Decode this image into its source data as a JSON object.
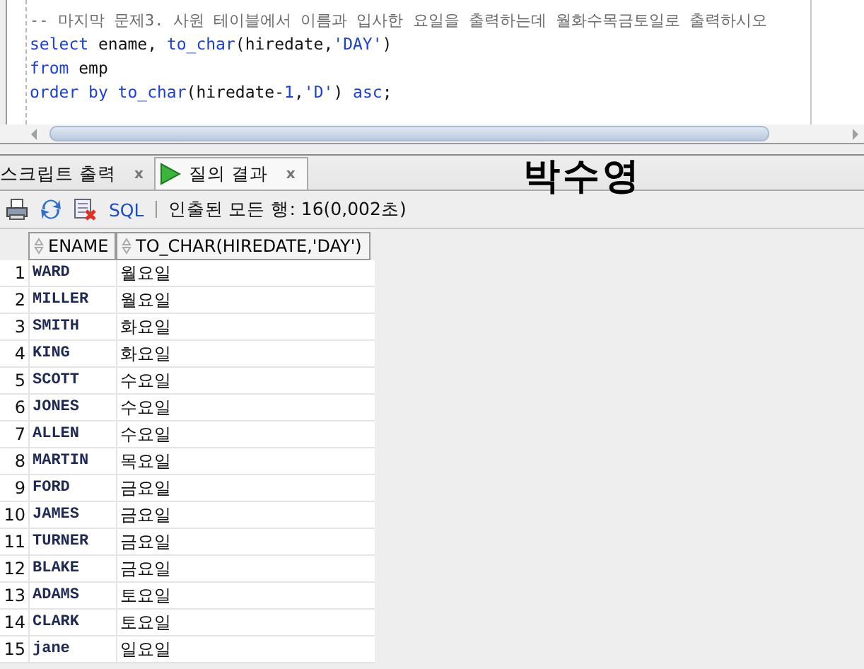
{
  "editor": {
    "lines": [
      [
        {
          "kind": "comment",
          "text": "-- 마지막 문제3. 사원 테이블에서 이름과 입사한 요일을 출력하는데 월화수목금토일로 출력하시오"
        }
      ],
      [
        {
          "kind": "keyword",
          "text": "select"
        },
        {
          "kind": "plain",
          "text": " ename, "
        },
        {
          "kind": "keyword",
          "text": "to_char"
        },
        {
          "kind": "plain",
          "text": "(hiredate,"
        },
        {
          "kind": "string",
          "text": "'DAY'"
        },
        {
          "kind": "plain",
          "text": ")"
        }
      ],
      [
        {
          "kind": "keyword",
          "text": "from"
        },
        {
          "kind": "plain",
          "text": " emp"
        }
      ],
      [
        {
          "kind": "keyword",
          "text": "order by to_char"
        },
        {
          "kind": "plain",
          "text": "(hiredate-"
        },
        {
          "kind": "string",
          "text": "1"
        },
        {
          "kind": "plain",
          "text": ","
        },
        {
          "kind": "string",
          "text": "'D'"
        },
        {
          "kind": "plain",
          "text": ") "
        },
        {
          "kind": "keyword",
          "text": "asc"
        },
        {
          "kind": "plain",
          "text": ";"
        }
      ]
    ]
  },
  "tabs": [
    {
      "label": "스크립트 출력",
      "selected": false,
      "close": "x"
    },
    {
      "label": "질의 결과",
      "selected": true,
      "close": "x"
    }
  ],
  "annotation": "박수영",
  "toolbar": {
    "sql_label": "SQL",
    "status": "인출된 모든 행: 16(0,002초)"
  },
  "table": {
    "columns": [
      "ENAME",
      "TO_CHAR(HIREDATE,'DAY')"
    ],
    "rows": [
      {
        "num": "1",
        "ename": "WARD",
        "day": "월요일"
      },
      {
        "num": "2",
        "ename": "MILLER",
        "day": "월요일"
      },
      {
        "num": "3",
        "ename": "SMITH",
        "day": "화요일"
      },
      {
        "num": "4",
        "ename": "KING",
        "day": "화요일"
      },
      {
        "num": "5",
        "ename": "SCOTT",
        "day": "수요일"
      },
      {
        "num": "6",
        "ename": "JONES",
        "day": "수요일"
      },
      {
        "num": "7",
        "ename": "ALLEN",
        "day": "수요일"
      },
      {
        "num": "8",
        "ename": "MARTIN",
        "day": "목요일"
      },
      {
        "num": "9",
        "ename": "FORD",
        "day": "금요일"
      },
      {
        "num": "10",
        "ename": "JAMES",
        "day": "금요일"
      },
      {
        "num": "11",
        "ename": "TURNER",
        "day": "금요일"
      },
      {
        "num": "12",
        "ename": "BLAKE",
        "day": "금요일"
      },
      {
        "num": "13",
        "ename": "ADAMS",
        "day": "토요일"
      },
      {
        "num": "14",
        "ename": "CLARK",
        "day": "토요일"
      },
      {
        "num": "15",
        "ename": "jane",
        "day": "일요일"
      }
    ]
  }
}
